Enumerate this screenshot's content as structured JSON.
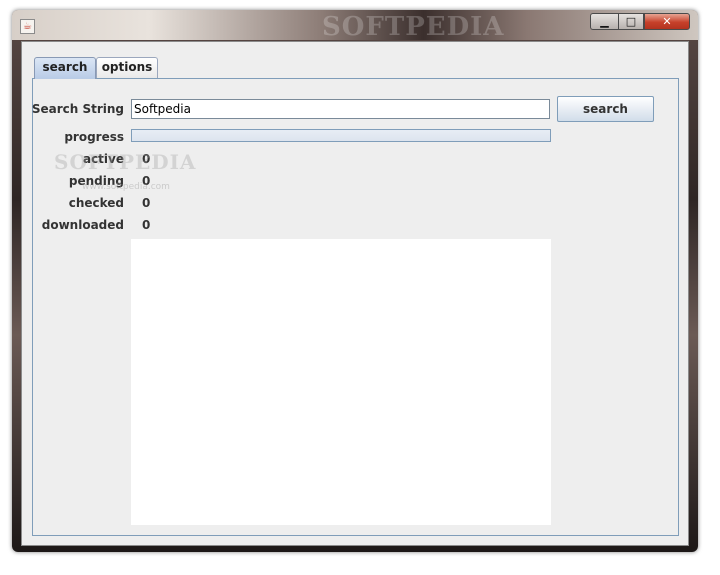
{
  "window": {
    "title_watermark": "SOFTPEDIA",
    "icon": "java-icon",
    "controls": {
      "minimize": "▁",
      "maximize": "□",
      "close": "✕"
    }
  },
  "tabs": [
    {
      "label": "search",
      "selected": true
    },
    {
      "label": "options",
      "selected": false
    }
  ],
  "search": {
    "label": "Search String",
    "value": "Softpedia",
    "button_label": "search"
  },
  "progress": {
    "label": "progress",
    "fraction": 0
  },
  "stats": [
    {
      "label": "active",
      "value": "0"
    },
    {
      "label": "pending",
      "value": "0"
    },
    {
      "label": "checked",
      "value": "0"
    },
    {
      "label": "downloaded",
      "value": "0"
    }
  ],
  "watermark": {
    "logo": "SOFTPEDIA",
    "url": "www.softpedia.com"
  },
  "colors": {
    "accent": "#7f9db9",
    "close_button": "#c7412b",
    "selected_tab": "#b8cbe6"
  }
}
